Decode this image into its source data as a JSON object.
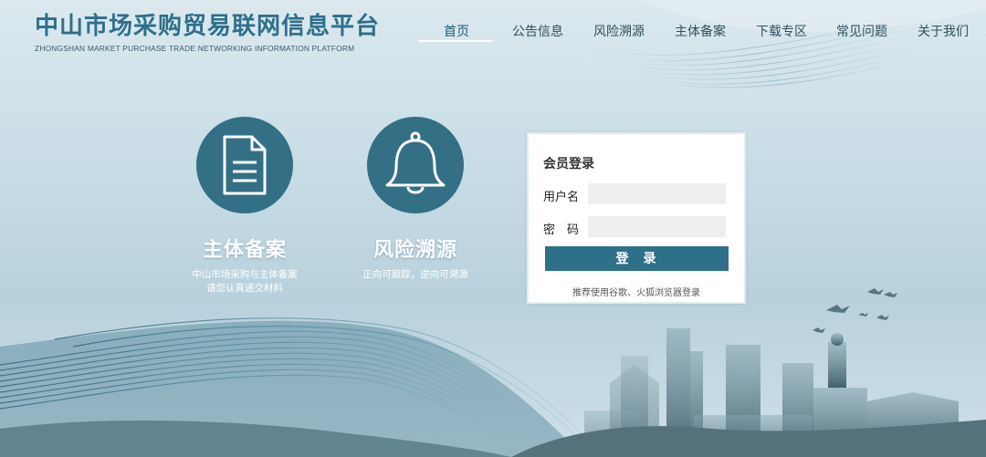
{
  "brand": {
    "title": "中山市场采购贸易联网信息平台",
    "subtitle": "ZHONGSHAN MARKET PURCHASE TRADE NETWORKING INFORMATION PLATFORM"
  },
  "nav": {
    "items": [
      "首页",
      "公告信息",
      "风险溯源",
      "主体备案",
      "下载专区",
      "常见问题",
      "关于我们"
    ],
    "active": "首页"
  },
  "features": [
    {
      "icon": "document-icon",
      "title": "主体备案",
      "desc_line1": "中山市场采购与主体备案",
      "desc_line2": "请您认真递交材料"
    },
    {
      "icon": "bell-icon",
      "title": "风险溯源",
      "desc_line1": "正向可跟踪，逆向可溯源"
    }
  ],
  "login": {
    "title": "会员登录",
    "username_label": "用户名",
    "username_value": "",
    "password_label": "密　码",
    "password_value": "",
    "button_label": "登录",
    "note": "推荐使用谷歌、火狐浏览器登录"
  },
  "colors": {
    "accent": "#336f85",
    "button": "#2f7089",
    "brand_text": "#2e6f8a"
  }
}
